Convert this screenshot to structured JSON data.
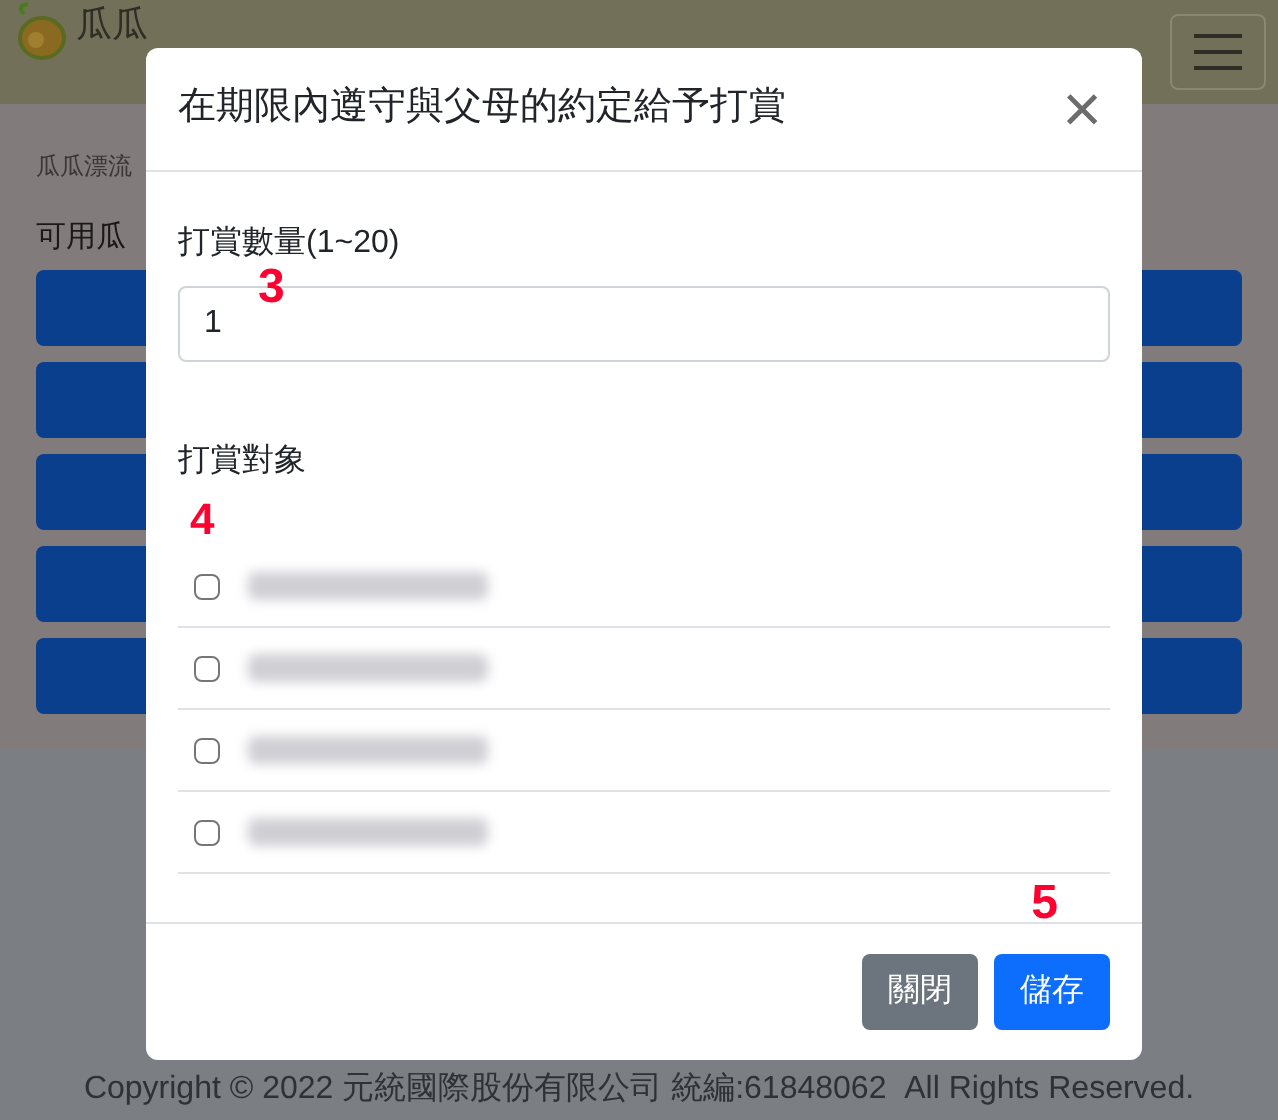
{
  "header": {
    "logo_text": "瓜瓜"
  },
  "page": {
    "breadcrumb": "瓜瓜漂流",
    "heading": "可用瓜"
  },
  "modal": {
    "title": "在期限內遵守與父母的約定給予打賞",
    "close": "×",
    "quantity": {
      "label": "打賞數量(1~20)",
      "value": "1"
    },
    "recipients_label": "打賞對象",
    "recipients": [
      {
        "checked": false,
        "kind": "blurred"
      },
      {
        "checked": false,
        "kind": "blurred"
      },
      {
        "checked": false,
        "kind": "blurred"
      },
      {
        "checked": false,
        "kind": "blurred"
      }
    ],
    "buttons": [
      {
        "label": "關閉",
        "kind": "secondary"
      },
      {
        "label": "儲存",
        "kind": "primary"
      }
    ]
  },
  "annotations": [
    "3",
    "4",
    "5"
  ],
  "footer": {
    "copyright": "Copyright © 2022 元統國際股份有限公司 統編:61848062  All Rights Reserved."
  }
}
